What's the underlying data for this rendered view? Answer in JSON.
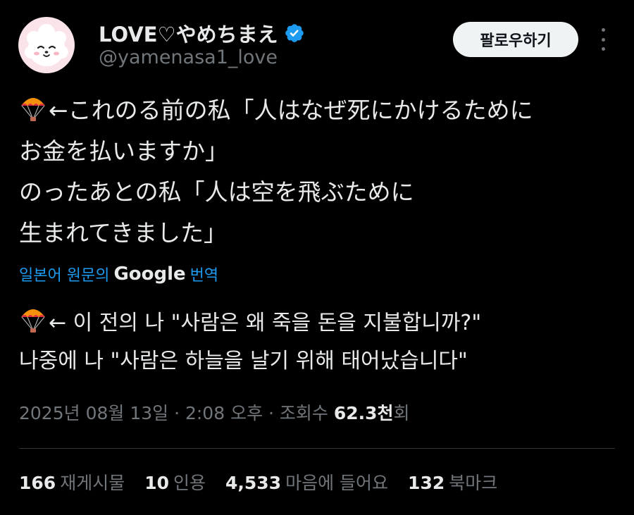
{
  "colors": {
    "background": "#000000",
    "text": "#e7e9ea",
    "muted": "#71767b",
    "link": "#1d9bf0",
    "verified": "#1d9bf0",
    "follow_button_bg": "#eff3f4",
    "avatar_bg": "#fbe3ea"
  },
  "user": {
    "display_name": "LOVE♡やめちまえ",
    "handle": "@yamenasa1_love",
    "verified_icon": "verified-badge-icon",
    "avatar_icon": "white-dog-face-avatar"
  },
  "header": {
    "follow_label": "팔로우하기",
    "more_icon": "more-vertical-icon"
  },
  "tweet": {
    "emoji": "parachute-emoji",
    "original_lines": [
      "←これのる前の私「人はなぜ死にかけるために",
      "お金を払いますか」",
      "のったあとの私「人は空を飛ぶために",
      "生まれてきました」"
    ],
    "translate_prefix": "일본어 원문의",
    "translate_brand": "Google",
    "translate_suffix": "번역",
    "translated_lines": [
      "← 이 전의 나 \"사람은 왜 죽을 돈을 지불합니까?\"",
      "나중에 나 \"사람은 하늘을 날기 위해 태어났습니다\""
    ]
  },
  "meta": {
    "date_time": "2025년 08월 13일 · 2:08 오후 · 조회수 ",
    "views_number": "62.3천",
    "views_suffix": "회"
  },
  "stats": {
    "retweets_count": "166",
    "retweets_label": "재게시물",
    "quotes_count": "10",
    "quotes_label": "인용",
    "likes_count": "4,533",
    "likes_label": "마음에 들어요",
    "bookmarks_count": "132",
    "bookmarks_label": "북마크"
  }
}
